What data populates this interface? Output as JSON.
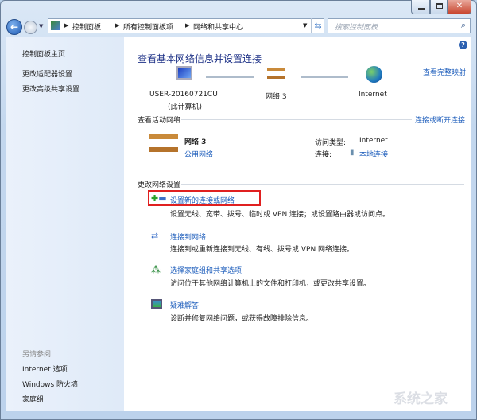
{
  "window": {
    "controls": [
      "minimize",
      "maximize",
      "close"
    ]
  },
  "address": {
    "crumbs": [
      "控制面板",
      "所有控制面板项",
      "网络和共享中心"
    ],
    "search_placeholder": "搜索控制面板"
  },
  "sidebar": {
    "home": "控制面板主页",
    "items": [
      "更改适配器设置",
      "更改高级共享设置"
    ],
    "see_also_title": "另请参阅",
    "see_also": [
      "Internet 选项",
      "Windows 防火墙",
      "家庭组"
    ]
  },
  "main": {
    "title": "查看基本网络信息并设置连接",
    "full_map": "查看完整映射",
    "map": {
      "computer": "USER-20160721CU",
      "computer_sub": "(此计算机)",
      "network": "网络  3",
      "internet": "Internet"
    },
    "active_title": "查看活动网络",
    "connect_disconnect": "连接或断开连接",
    "active": {
      "name": "网络  3",
      "type": "公用网络",
      "access_label": "访问类型:",
      "access_value": "Internet",
      "conn_label": "连接:",
      "conn_value": "本地连接"
    },
    "change_title": "更改网络设置",
    "tasks": [
      {
        "title": "设置新的连接或网络",
        "desc": "设置无线、宽带、拨号、临时或 VPN 连接；或设置路由器或访问点。"
      },
      {
        "title": "连接到网络",
        "desc": "连接到或重新连接到无线、有线、拨号或 VPN 网络连接。"
      },
      {
        "title": "选择家庭组和共享选项",
        "desc": "访问位于其他网络计算机上的文件和打印机，或更改共享设置。"
      },
      {
        "title": "疑难解答",
        "desc": "诊断并修复网络问题，或获得故障排除信息。"
      }
    ]
  },
  "watermark": "系统之家",
  "colors": {
    "link": "#1e5ebc",
    "title": "#1e3287",
    "highlight": "#e02020"
  }
}
